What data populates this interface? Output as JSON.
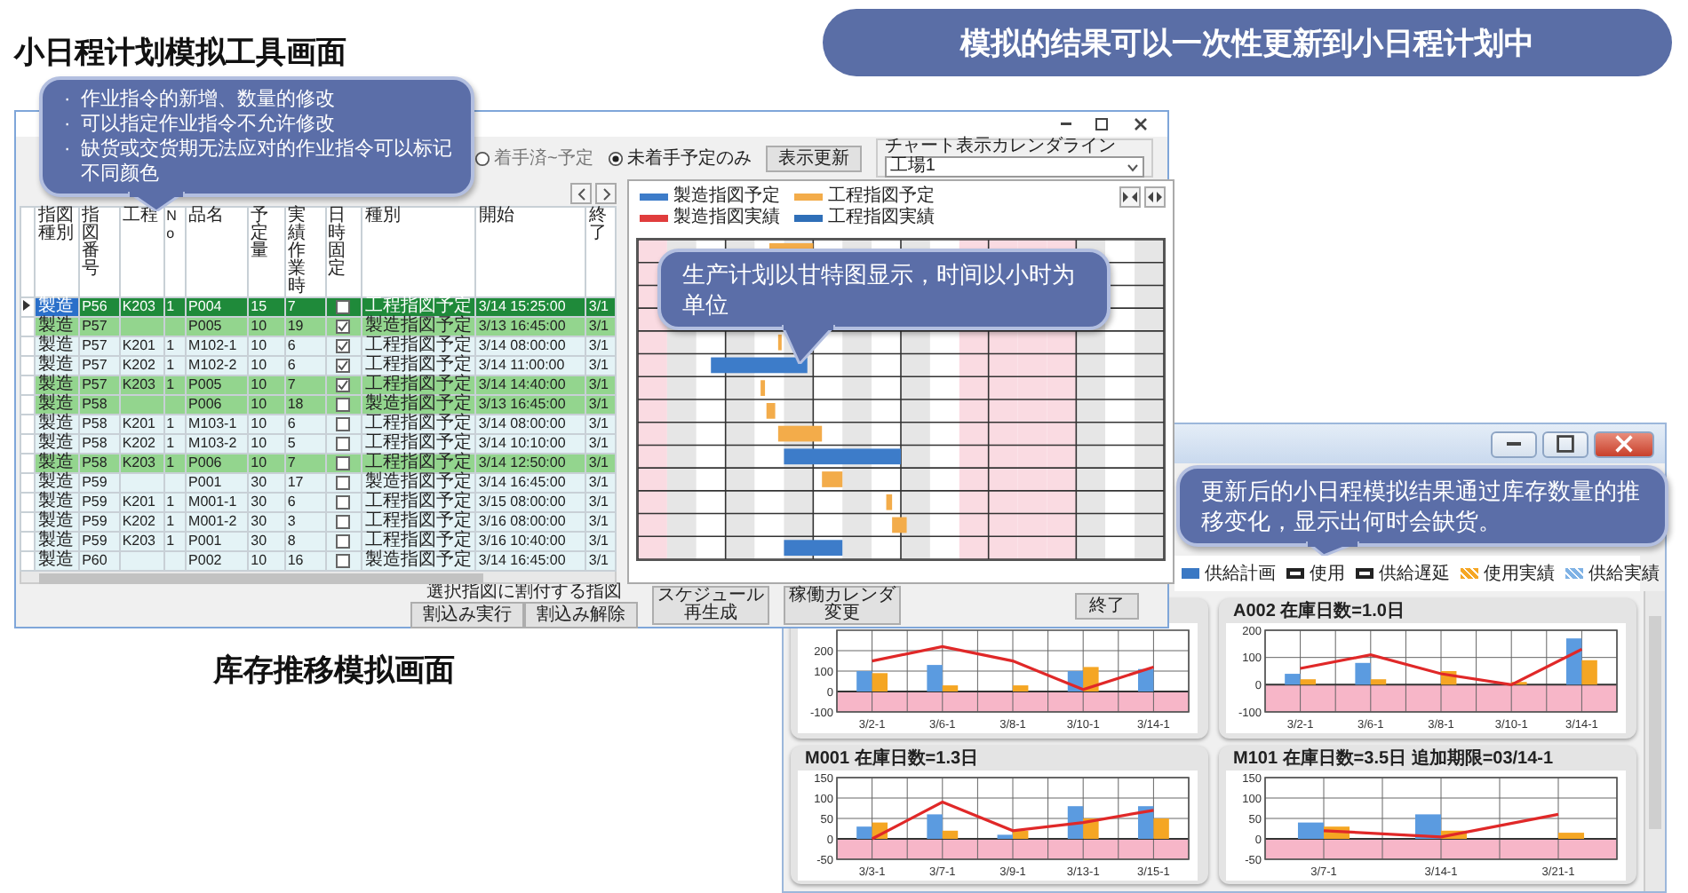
{
  "simulation_heading": "小日程计划模拟工具画面",
  "banner": "模拟的结果可以一次性更新到小日程计划中",
  "inventory_heading": "库存推移模拟画面",
  "simulation_window": {
    "toolbar": {
      "radios": [
        {
          "label": "着手済~予定",
          "selected": false
        },
        {
          "label": "未着手予定のみ",
          "selected": true
        }
      ],
      "refresh_button": "表示更新",
      "calendar_group": {
        "label": "チャート表示カレンダライン",
        "value": "工場1"
      }
    },
    "table": {
      "columns": [
        "指図種別",
        "指図番号",
        "工程",
        "No",
        "品名",
        "予定量",
        "実績作業時",
        "日時固定",
        "種別",
        "開始",
        "終了"
      ],
      "rows": [
        {
          "type": "製造",
          "order": "P56",
          "process": "K203",
          "no": "1",
          "item": "P004",
          "qty": "15",
          "hours": "7",
          "fixed": false,
          "kind": "工程指図予定",
          "start": "3/14 15:25:00",
          "end": "3/1",
          "selected": true,
          "highlighted": true
        },
        {
          "type": "製造",
          "order": "P57",
          "item": "P005",
          "qty": "10",
          "hours": "19",
          "fixed": true,
          "kind": "製造指図予定",
          "start": "3/13 16:45:00",
          "end": "3/1",
          "selected": false,
          "highlighted": true
        },
        {
          "type": "製造",
          "order": "P57",
          "process": "K201",
          "no": "1",
          "item": "M102-1",
          "qty": "10",
          "hours": "6",
          "fixed": true,
          "kind": "工程指図予定",
          "start": "3/14 08:00:00",
          "end": "3/1",
          "selected": false,
          "highlighted": false
        },
        {
          "type": "製造",
          "order": "P57",
          "process": "K202",
          "no": "1",
          "item": "M102-2",
          "qty": "10",
          "hours": "6",
          "fixed": true,
          "kind": "工程指図予定",
          "start": "3/14 11:00:00",
          "end": "3/1",
          "selected": false,
          "highlighted": false
        },
        {
          "type": "製造",
          "order": "P57",
          "process": "K203",
          "no": "1",
          "item": "P005",
          "qty": "10",
          "hours": "7",
          "fixed": true,
          "kind": "工程指図予定",
          "start": "3/14 14:40:00",
          "end": "3/1",
          "selected": false,
          "highlighted": true
        },
        {
          "type": "製造",
          "order": "P58",
          "item": "P006",
          "qty": "10",
          "hours": "18",
          "fixed": false,
          "kind": "製造指図予定",
          "start": "3/13 16:45:00",
          "end": "3/1",
          "selected": false,
          "highlighted": true
        },
        {
          "type": "製造",
          "order": "P58",
          "process": "K201",
          "no": "1",
          "item": "M103-1",
          "qty": "10",
          "hours": "6",
          "fixed": false,
          "kind": "工程指図予定",
          "start": "3/14 08:00:00",
          "end": "3/1",
          "selected": false,
          "highlighted": false
        },
        {
          "type": "製造",
          "order": "P58",
          "process": "K202",
          "no": "1",
          "item": "M103-2",
          "qty": "10",
          "hours": "5",
          "fixed": false,
          "kind": "工程指図予定",
          "start": "3/14 10:10:00",
          "end": "3/1",
          "selected": false,
          "highlighted": false
        },
        {
          "type": "製造",
          "order": "P58",
          "process": "K203",
          "no": "1",
          "item": "P006",
          "qty": "10",
          "hours": "7",
          "fixed": false,
          "kind": "工程指図予定",
          "start": "3/14 12:50:00",
          "end": "3/1",
          "selected": false,
          "highlighted": true
        },
        {
          "type": "製造",
          "order": "P59",
          "item": "P001",
          "qty": "30",
          "hours": "17",
          "fixed": false,
          "kind": "製造指図予定",
          "start": "3/14 16:45:00",
          "end": "3/1",
          "selected": false,
          "highlighted": false
        },
        {
          "type": "製造",
          "order": "P59",
          "process": "K201",
          "no": "1",
          "item": "M001-1",
          "qty": "30",
          "hours": "6",
          "fixed": false,
          "kind": "工程指図予定",
          "start": "3/15 08:00:00",
          "end": "3/1",
          "selected": false,
          "highlighted": false
        },
        {
          "type": "製造",
          "order": "P59",
          "process": "K202",
          "no": "1",
          "item": "M001-2",
          "qty": "30",
          "hours": "3",
          "fixed": false,
          "kind": "工程指図予定",
          "start": "3/16 08:00:00",
          "end": "3/1",
          "selected": false,
          "highlighted": false
        },
        {
          "type": "製造",
          "order": "P59",
          "process": "K203",
          "no": "1",
          "item": "P001",
          "qty": "30",
          "hours": "8",
          "fixed": false,
          "kind": "工程指図予定",
          "start": "3/16 10:40:00",
          "end": "3/1",
          "selected": false,
          "highlighted": false
        },
        {
          "type": "製造",
          "order": "P60",
          "item": "P002",
          "qty": "10",
          "hours": "16",
          "fixed": false,
          "kind": "製造指図予定",
          "start": "3/14 16:45:00",
          "end": "3/1",
          "selected": false,
          "highlighted": false
        }
      ]
    },
    "gantt": {
      "legend": [
        {
          "label": "製造指図予定",
          "color": "#3d7cc9"
        },
        {
          "label": "工程指図予定",
          "color": "#f3ac4a"
        },
        {
          "label": "製造指図実績",
          "color": "#e03c3c"
        },
        {
          "label": "工程指図実績",
          "color": "#2f6fb8"
        }
      ]
    },
    "bottom": {
      "group_label": "選択指図に割付する指図",
      "group_buttons": [
        "割込み実行",
        "割込み解除"
      ],
      "actions": [
        "スケジュール再生成",
        "稼働カレンダ変更"
      ],
      "close_button": "終了"
    }
  },
  "inventory_window": {
    "legend": [
      {
        "label": "供給計画",
        "kind": "solid",
        "color": "#3a78c4"
      },
      {
        "label": "使用",
        "kind": "outline",
        "color": "#222222"
      },
      {
        "label": "供給遅延",
        "kind": "outline",
        "color": "#222222"
      },
      {
        "label": "使用実績",
        "kind": "hatched",
        "color": "#f5a623"
      },
      {
        "label": "供給実績",
        "kind": "hatched",
        "color": "#7fb2e5"
      }
    ],
    "charts": [
      {
        "chart_data": {
          "type": "bar",
          "grid": true,
          "bands": [
            {
              "axis": "y",
              "from": -100,
              "to": 0,
              "color": "#f7b6c8"
            }
          ],
          "categories": [
            "3/2-1",
            "3/6-1",
            "3/8-1",
            "3/10-1",
            "3/14-1"
          ],
          "ylim": [
            -100,
            300
          ],
          "yticks": [
            -100,
            0,
            100,
            200
          ],
          "series": [
            {
              "type": "bar",
              "color": "#5b9be0",
              "values": [
                100,
                130,
                null,
                100,
                110
              ]
            },
            {
              "type": "bar",
              "color": "#f5a623",
              "values": [
                90,
                30,
                30,
                120,
                null
              ]
            },
            {
              "type": "line",
              "color": "#e02828",
              "values": [
                150,
                220,
                150,
                10,
                120
              ]
            }
          ]
        }
      },
      {
        "chart_data": {
          "type": "bar",
          "grid": true,
          "bands": [
            {
              "axis": "y",
              "from": -100,
              "to": 0,
              "color": "#f7b6c8"
            }
          ],
          "title": "A002 在庫日数=1.0日",
          "categories": [
            "3/2-1",
            "3/6-1",
            "3/8-1",
            "3/10-1",
            "3/14-1"
          ],
          "ylim": [
            -100,
            200
          ],
          "yticks": [
            -100,
            0,
            100,
            200
          ],
          "series": [
            {
              "type": "bar",
              "color": "#5b9be0",
              "values": [
                40,
                80,
                null,
                null,
                170
              ]
            },
            {
              "type": "bar",
              "color": "#f5a623",
              "values": [
                20,
                20,
                50,
                10,
                90
              ]
            },
            {
              "type": "line",
              "color": "#e02828",
              "values": [
                60,
                110,
                40,
                0,
                130
              ]
            }
          ]
        }
      },
      {
        "chart_data": {
          "type": "bar",
          "grid": true,
          "bands": [
            {
              "axis": "y",
              "from": -50,
              "to": 0,
              "color": "#f7b6c8"
            }
          ],
          "title": "M001 在庫日数=1.3日",
          "categories": [
            "3/3-1",
            "3/7-1",
            "3/9-1",
            "3/13-1",
            "3/15-1"
          ],
          "ylim": [
            -50,
            150
          ],
          "yticks": [
            -50,
            0,
            50,
            100,
            150
          ],
          "series": [
            {
              "type": "bar",
              "color": "#5b9be0",
              "values": [
                30,
                60,
                10,
                80,
                80
              ]
            },
            {
              "type": "bar",
              "color": "#f5a623",
              "values": [
                40,
                20,
                20,
                50,
                50
              ]
            },
            {
              "type": "line",
              "color": "#e02828",
              "values": [
                0,
                90,
                20,
                40,
                70
              ]
            }
          ]
        }
      },
      {
        "chart_data": {
          "type": "bar",
          "grid": true,
          "bands": [
            {
              "axis": "y",
              "from": -50,
              "to": 0,
              "color": "#f7b6c8"
            }
          ],
          "title": "M101 在庫日数=3.5日 追加期限=03/14-1",
          "categories": [
            "3/7-1",
            "3/14-1",
            "3/21-1"
          ],
          "ylim": [
            -50,
            150
          ],
          "yticks": [
            -50,
            0,
            50,
            100,
            150
          ],
          "series": [
            {
              "type": "bar",
              "color": "#5b9be0",
              "values": [
                40,
                60,
                null
              ]
            },
            {
              "type": "bar",
              "color": "#f5a623",
              "values": [
                30,
                20,
                15
              ]
            },
            {
              "type": "line",
              "color": "#e02828",
              "values": [
                20,
                5,
                60
              ]
            }
          ]
        }
      }
    ]
  },
  "callouts": [
    {
      "kind": "list",
      "bullet": "·",
      "items": [
        "作业指令的新增、数量的修改",
        "可以指定作业指令不允许修改",
        "缺货或交货期无法应对的作业指令可以标记不同颜色"
      ]
    },
    {
      "kind": "text",
      "text": "生产计划以甘特图显示，时间以小时为单位"
    },
    {
      "kind": "text",
      "text": "更新后的小日程模拟结果通过库存数量的推移变化，显示出何时会缺货。"
    }
  ]
}
